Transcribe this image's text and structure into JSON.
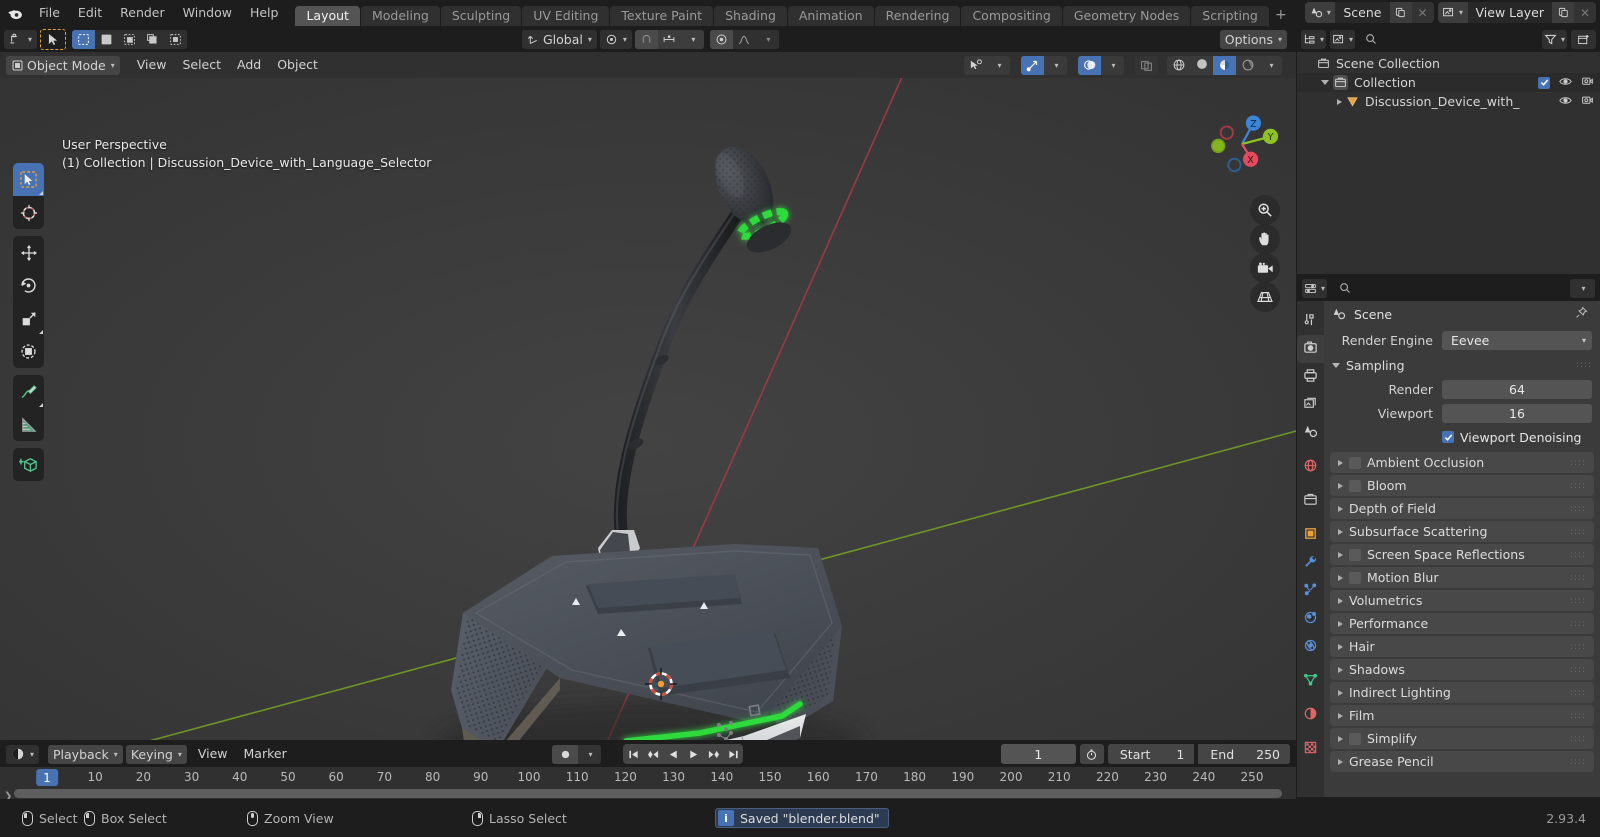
{
  "app": {
    "name": "Blender",
    "version": "2.93.4"
  },
  "topbar": {
    "logo_icon": "blender-logo-icon",
    "menus": [
      "File",
      "Edit",
      "Render",
      "Window",
      "Help"
    ],
    "workspaces": [
      {
        "label": "Layout",
        "active": true
      },
      {
        "label": "Modeling",
        "active": false
      },
      {
        "label": "Sculpting",
        "active": false
      },
      {
        "label": "UV Editing",
        "active": false
      },
      {
        "label": "Texture Paint",
        "active": false
      },
      {
        "label": "Shading",
        "active": false
      },
      {
        "label": "Animation",
        "active": false
      },
      {
        "label": "Rendering",
        "active": false
      },
      {
        "label": "Compositing",
        "active": false
      },
      {
        "label": "Geometry Nodes",
        "active": false
      },
      {
        "label": "Scripting",
        "active": false
      }
    ],
    "add_workspace_label": "+",
    "scene": {
      "name": "Scene",
      "icon": "scene-icon",
      "new_icon": "duplicate-icon",
      "unlink_icon": "x-icon"
    },
    "view_layer": {
      "name": "View Layer",
      "icon": "view-layer-icon",
      "new_icon": "duplicate-icon",
      "unlink_icon": "x-icon"
    }
  },
  "viewport": {
    "header": {
      "editor_type_icon": "editor-type-3dview-icon",
      "mode": "Object Mode",
      "mode_icon": "object-mode-icon",
      "menus": [
        "View",
        "Select",
        "Add",
        "Object"
      ],
      "transform_orientation": "Global",
      "transform_orientation_icon": "orientation-icon",
      "pivot_icon": "pivot-point-icon",
      "snap_icon": "snap-magnet-icon",
      "snap_to_icon": "snap-increment-icon",
      "proportional_icon": "proportional-edit-icon",
      "falloff_icon": "falloff-smooth-icon",
      "options_label": "Options",
      "visibility_icon": "object-types-visibility-icon",
      "gizmo_icon": "gizmo-icon",
      "overlay_icon": "overlays-icon",
      "xray_icon": "xray-toggle-icon",
      "shading_modes": [
        "wireframe",
        "solid",
        "material-preview",
        "rendered"
      ],
      "shading_active_index": 2
    },
    "overlay_text": {
      "perspective": "User Perspective",
      "breadcrumb": "(1) Collection | Discussion_Device_with_Language_Selector"
    },
    "toolbar": [
      {
        "name": "tweak-select-box-tool",
        "icon": "cursor-arrow-icon",
        "active": true,
        "has_expand": true
      },
      {
        "name": "cursor-tool",
        "icon": "3d-cursor-icon",
        "active": false,
        "has_expand": false
      },
      {
        "name": "move-tool",
        "icon": "move-arrows-icon",
        "active": false,
        "has_expand": false
      },
      {
        "name": "rotate-tool",
        "icon": "rotate-icon",
        "active": false,
        "has_expand": false
      },
      {
        "name": "scale-tool",
        "icon": "scale-icon",
        "active": false,
        "has_expand": true
      },
      {
        "name": "transform-tool",
        "icon": "transform-icon",
        "active": false,
        "has_expand": false
      },
      {
        "name": "annotate-tool",
        "icon": "annotate-pencil-icon",
        "active": false,
        "has_expand": true
      },
      {
        "name": "measure-tool",
        "icon": "measure-ruler-icon",
        "active": false,
        "has_expand": false
      },
      {
        "name": "add-cube-tool",
        "icon": "add-cube-icon",
        "active": false,
        "has_expand": false
      }
    ],
    "nav_gizmo": {
      "axes": [
        "Z",
        "Y",
        "X"
      ],
      "colors": {
        "x": "#e54b5e",
        "y": "#8ec21f",
        "z": "#3b86d9"
      }
    },
    "nav_buttons": [
      {
        "name": "zoom-view-button",
        "icon": "magnifier-icon"
      },
      {
        "name": "move-view-button",
        "icon": "hand-icon"
      },
      {
        "name": "camera-view-button",
        "icon": "camera-icon"
      },
      {
        "name": "toggle-ortho-perspective-button",
        "icon": "grid-perspective-icon"
      }
    ],
    "scene_object": {
      "name": "Discussion_Device_with_Language_Selector",
      "accent_color": "#2fdb3c",
      "body_color": "#4b5058",
      "grid_color": "#555555",
      "x_axis_color": "#a33b47",
      "y_axis_color": "#7ba428"
    }
  },
  "outliner": {
    "header": {
      "editor_type_icon": "editor-type-outliner-icon",
      "display_mode_icon": "view-layer-icon",
      "search_placeholder": "",
      "filter_icon": "funnel-filter-icon",
      "new_collection_icon": "new-collection-icon"
    },
    "rows": [
      {
        "label": "Scene Collection",
        "icon": "collection-icon",
        "indent": 0,
        "expander": "none",
        "checkbox": false,
        "eye": false,
        "camera": false
      },
      {
        "label": "Collection",
        "icon": "collection-icon",
        "indent": 1,
        "expander": "open",
        "checkbox": true,
        "eye": true,
        "camera": true
      },
      {
        "label": "Discussion_Device_with_",
        "icon": "mesh-data-icon",
        "indent": 2,
        "expander": "closed",
        "checkbox": false,
        "eye": true,
        "camera": true
      }
    ]
  },
  "properties": {
    "header": {
      "editor_type_icon": "editor-type-properties-icon",
      "search_placeholder": "",
      "options_caret_icon": "chevron-down-icon"
    },
    "tabs": [
      {
        "name": "tool",
        "icon": "tool-icon",
        "color": "#cfcfcf",
        "active": false
      },
      {
        "name": "render",
        "icon": "render-camera-back-icon",
        "color": "#cfcfcf",
        "active": true
      },
      {
        "name": "output",
        "icon": "printer-output-icon",
        "color": "#cfcfcf",
        "active": false
      },
      {
        "name": "view-layer",
        "icon": "view-layer-images-icon",
        "color": "#cfcfcf",
        "active": false
      },
      {
        "name": "scene",
        "icon": "scene-cone-icon",
        "color": "#cfcfcf",
        "active": false
      },
      {
        "name": "world",
        "icon": "world-globe-icon",
        "color": "#e06666",
        "active": false
      },
      {
        "name": "collection",
        "icon": "collection-box-icon",
        "color": "#cfcfcf",
        "active": false
      },
      {
        "name": "object",
        "icon": "object-square-icon",
        "color": "#e8a23a",
        "active": false
      },
      {
        "name": "modifiers",
        "icon": "wrench-icon",
        "color": "#5a8fd8",
        "active": false
      },
      {
        "name": "particles",
        "icon": "particles-icon",
        "color": "#5a8fd8",
        "active": false
      },
      {
        "name": "physics",
        "icon": "physics-orbit-icon",
        "color": "#5a8fd8",
        "active": false
      },
      {
        "name": "constraints",
        "icon": "constraints-icon",
        "color": "#5a8fd8",
        "active": false
      },
      {
        "name": "object-data",
        "icon": "mesh-data-triangle-icon",
        "color": "#3ec98a",
        "active": false
      },
      {
        "name": "material",
        "icon": "material-sphere-icon",
        "color": "#e06666",
        "active": false
      },
      {
        "name": "texture",
        "icon": "texture-checker-icon",
        "color": "#e06666",
        "active": false
      }
    ],
    "breadcrumb": {
      "label": "Scene",
      "icon": "scene-cone-icon",
      "pin_icon": "pin-icon"
    },
    "render_engine": {
      "label": "Render Engine",
      "value": "Eevee"
    },
    "sampling": {
      "title": "Sampling",
      "expanded": true,
      "fields": [
        {
          "label": "Render",
          "value": "64"
        },
        {
          "label": "Viewport",
          "value": "16"
        }
      ],
      "denoising": {
        "label": "Viewport Denoising",
        "checked": true
      }
    },
    "panels": [
      {
        "label": "Ambient Occlusion",
        "checkbox": true,
        "checked": false
      },
      {
        "label": "Bloom",
        "checkbox": true,
        "checked": false
      },
      {
        "label": "Depth of Field",
        "checkbox": false,
        "checked": false
      },
      {
        "label": "Subsurface Scattering",
        "checkbox": false,
        "checked": false
      },
      {
        "label": "Screen Space Reflections",
        "checkbox": true,
        "checked": false
      },
      {
        "label": "Motion Blur",
        "checkbox": true,
        "checked": false
      },
      {
        "label": "Volumetrics",
        "checkbox": false,
        "checked": false
      },
      {
        "label": "Performance",
        "checkbox": false,
        "checked": false
      },
      {
        "label": "Hair",
        "checkbox": false,
        "checked": false
      },
      {
        "label": "Shadows",
        "checkbox": false,
        "checked": false
      },
      {
        "label": "Indirect Lighting",
        "checkbox": false,
        "checked": false
      },
      {
        "label": "Film",
        "checkbox": false,
        "checked": false
      },
      {
        "label": "Simplify",
        "checkbox": true,
        "checked": false
      },
      {
        "label": "Grease Pencil",
        "checkbox": false,
        "checked": false
      }
    ]
  },
  "timeline": {
    "header": {
      "editor_type_icon": "editor-type-timeline-icon",
      "menus": [
        {
          "label": "Playback",
          "dropdown": true
        },
        {
          "label": "Keying",
          "dropdown": true
        },
        {
          "label": "View",
          "dropdown": false
        },
        {
          "label": "Marker",
          "dropdown": false
        }
      ],
      "auto_key_icon": "record-dot-icon",
      "transport": [
        "jump-to-start-icon",
        "jump-to-prev-keyframe-icon",
        "play-reverse-icon",
        "play-icon",
        "jump-to-next-keyframe-icon",
        "jump-to-end-icon"
      ],
      "current_frame": "1",
      "use_preview_range_icon": "stopwatch-icon",
      "start_label": "Start",
      "start_value": "1",
      "end_label": "End",
      "end_value": "250"
    },
    "ruler_ticks": [
      "10",
      "20",
      "30",
      "40",
      "50",
      "60",
      "70",
      "80",
      "90",
      "100",
      "110",
      "120",
      "130",
      "140",
      "150",
      "160",
      "170",
      "180",
      "190",
      "200",
      "210",
      "220",
      "230",
      "240",
      "250"
    ],
    "playhead_label": "1"
  },
  "statusbar": {
    "items": [
      {
        "label": "Select",
        "icon": "mouse-left-icon"
      },
      {
        "label": "Box Select",
        "icon": "mouse-left-drag-icon"
      },
      {
        "label": "Zoom View",
        "icon": "mouse-middle-icon"
      },
      {
        "label": "Lasso Select",
        "icon": "mouse-right-drag-icon"
      }
    ],
    "report": {
      "text": "Saved \"blender.blend\"",
      "icon": "info-icon"
    },
    "version": "2.93.4"
  }
}
